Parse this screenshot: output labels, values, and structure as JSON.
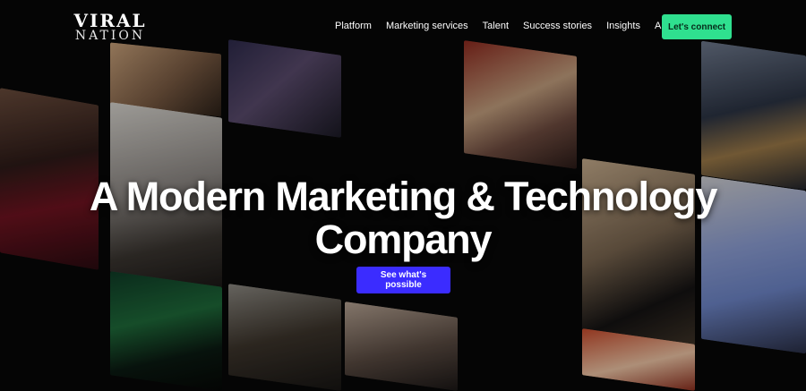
{
  "brand": {
    "line1": "VIRAL",
    "line2": "NATION"
  },
  "nav": {
    "items": [
      {
        "label": "Platform"
      },
      {
        "label": "Marketing services"
      },
      {
        "label": "Talent"
      },
      {
        "label": "Success stories"
      },
      {
        "label": "Insights"
      },
      {
        "label": "About"
      }
    ],
    "cta_label": "Let's connect"
  },
  "hero": {
    "headline": "A Modern Marketing & Technology Company",
    "button_label": "See what's possible"
  },
  "colors": {
    "cta_green": "#2fe08f",
    "primary_blue": "#3b2cff",
    "background": "#050505"
  }
}
